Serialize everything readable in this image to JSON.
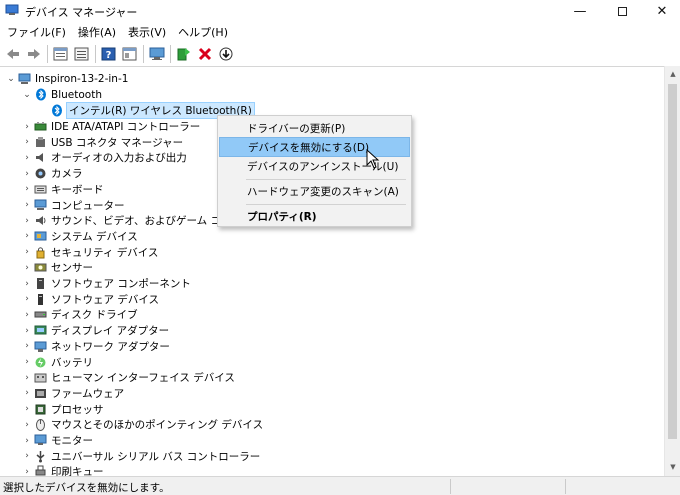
{
  "window": {
    "title": "デバイス マネージャー",
    "minimize": "—",
    "close": "✕"
  },
  "menu": [
    "ファイル(F)",
    "操作(A)",
    "表示(V)",
    "ヘルプ(H)"
  ],
  "toolbar": {
    "buttons": [
      "back-arrow-icon",
      "forward-arrow-icon",
      "properties-icon",
      "list-icon",
      "help-icon",
      "panel-icon",
      "monitor-scan-icon",
      "update-driver-icon",
      "uninstall-icon",
      "download-icon"
    ]
  },
  "tree": {
    "root": "Inspiron-13-2-in-1",
    "bluetooth": "Bluetooth",
    "bt_child": "インテル(R) ワイヤレス Bluetooth(R)",
    "categories": [
      "IDE ATA/ATAPI コントローラー",
      "USB コネクタ マネージャー",
      "オーディオの入力および出力",
      "カメラ",
      "キーボード",
      "コンピューター",
      "サウンド、ビデオ、およびゲーム コントローラー",
      "システム デバイス",
      "セキュリティ デバイス",
      "センサー",
      "ソフトウェア コンポーネント",
      "ソフトウェア デバイス",
      "ディスク ドライブ",
      "ディスプレイ アダプター",
      "ネットワーク アダプター",
      "バッテリ",
      "ヒューマン インターフェイス デバイス",
      "ファームウェア",
      "プロセッサ",
      "マウスとそのほかのポインティング デバイス",
      "モニター",
      "ユニバーサル シリアル バス コントローラー",
      "印刷キュー"
    ]
  },
  "context_menu": {
    "update_driver": "ドライバーの更新(P)",
    "disable_device": "デバイスを無効にする(D)",
    "uninstall_device": "デバイスのアンインストール(U)",
    "scan_hardware": "ハードウェア変更のスキャン(A)",
    "properties": "プロパティ(R)"
  },
  "status": {
    "text": "選択したデバイスを無効にします。"
  },
  "colors": {
    "selection": "#cce8ff",
    "menu_highlight": "#91c9f7",
    "bluetooth": "#0078d7",
    "uninstall_red": "#d9001b"
  }
}
